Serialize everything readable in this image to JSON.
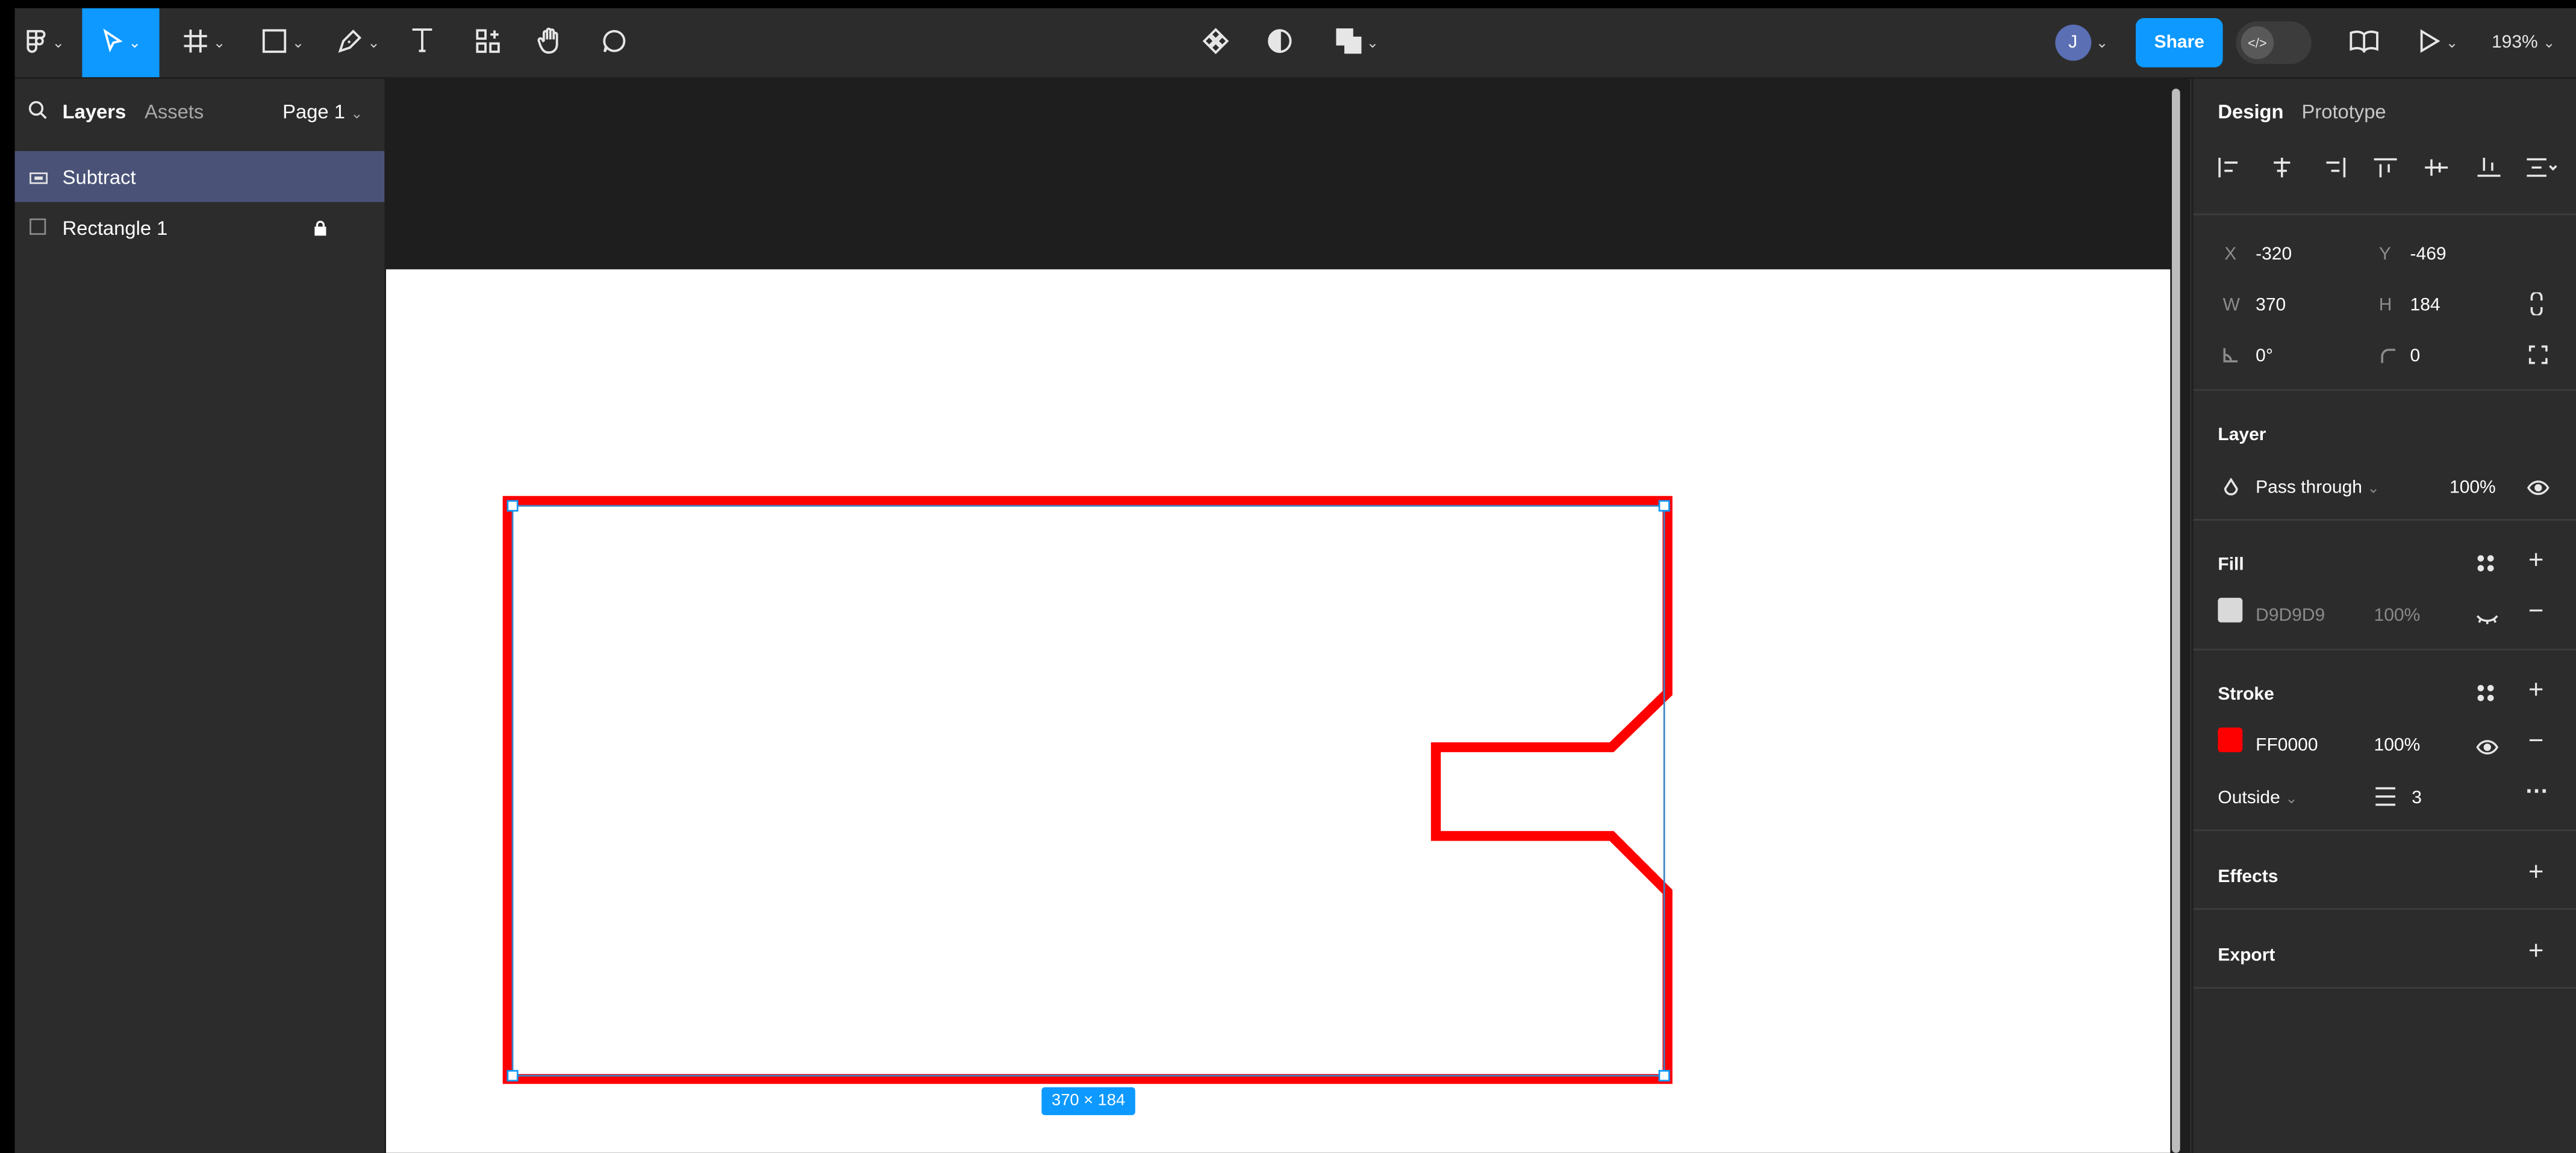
{
  "toolbar": {
    "share_label": "Share",
    "avatar_initial": "J",
    "zoom": "193%"
  },
  "layers_panel": {
    "tabs": [
      "Layers",
      "Assets"
    ],
    "page": "Page 1",
    "items": [
      {
        "name": "Subtract",
        "selected": true
      },
      {
        "name": "Rectangle 1",
        "locked": true
      }
    ]
  },
  "canvas": {
    "selection_size": "370 × 184",
    "stroke_color": "#FF0000"
  },
  "design_panel": {
    "tabs": [
      "Design",
      "Prototype"
    ],
    "position": {
      "x_label": "X",
      "x": "-320",
      "y_label": "Y",
      "y": "-469"
    },
    "size": {
      "w_label": "W",
      "w": "370",
      "h_label": "H",
      "h": "184"
    },
    "rotation": "0°",
    "corner_radius": "0",
    "layer": {
      "title": "Layer",
      "blend": "Pass through",
      "opacity": "100%"
    },
    "fill": {
      "title": "Fill",
      "color": "D9D9D9",
      "swatch": "#D9D9D9",
      "opacity": "100%"
    },
    "stroke": {
      "title": "Stroke",
      "color": "FF0000",
      "swatch": "#FF0000",
      "opacity": "100%",
      "position": "Outside",
      "weight": "3"
    },
    "effects": {
      "title": "Effects"
    },
    "export": {
      "title": "Export"
    }
  }
}
